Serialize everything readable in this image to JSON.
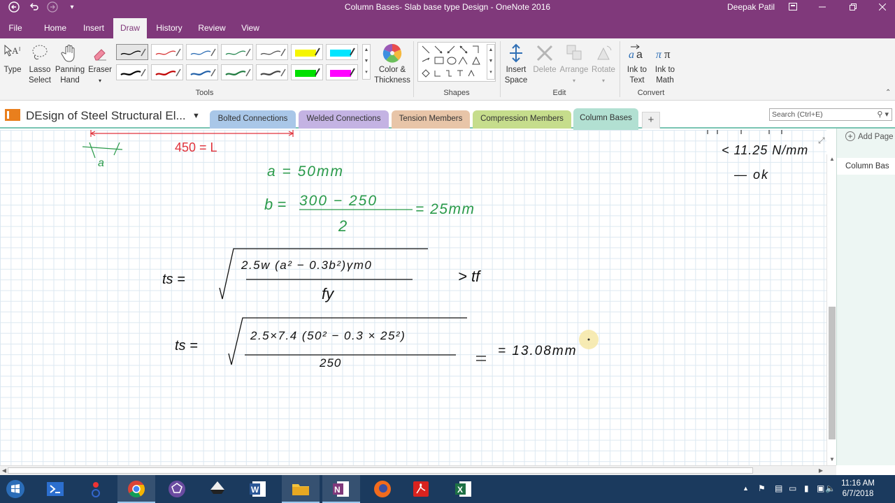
{
  "window": {
    "title": "Column Bases- Slab base type Design  -  OneNote 2016",
    "user": "Deepak Patil"
  },
  "menu": {
    "tabs": [
      "File",
      "Home",
      "Insert",
      "Draw",
      "History",
      "Review",
      "View"
    ],
    "active": "Draw"
  },
  "ribbon": {
    "type_label": "Type",
    "lasso_label": [
      "Lasso",
      "Select"
    ],
    "panning_label": [
      "Panning",
      "Hand"
    ],
    "eraser_label": "Eraser",
    "color_label": [
      "Color &",
      "Thickness"
    ],
    "insert_space_label": [
      "Insert",
      "Space"
    ],
    "delete_label": "Delete",
    "arrange_label": "Arrange",
    "rotate_label": "Rotate",
    "ink_text_label": [
      "Ink to",
      "Text"
    ],
    "ink_math_label": [
      "Ink to",
      "Math"
    ],
    "groups": {
      "tools": "Tools",
      "shapes": "Shapes",
      "edit": "Edit",
      "convert": "Convert"
    },
    "pen_colors": [
      "#000000",
      "#d83b3b",
      "#2f6fb5",
      "#2e8b57",
      "#555555",
      "#f5f500",
      "#00e5ff",
      "#000000",
      "#c00000",
      "#1f5fa8",
      "#1f7a3f",
      "#444444",
      "#00e000",
      "#ff00ff"
    ]
  },
  "notebook": {
    "name": "DEsign of Steel Structural El...",
    "sections": [
      {
        "label": "Bolted Connections",
        "color": "#a9c7e8"
      },
      {
        "label": "Welded Connections",
        "color": "#c4b3e3"
      },
      {
        "label": "Tension Members",
        "color": "#e8c5a8"
      },
      {
        "label": "Compression Members",
        "color": "#c6dd8c"
      },
      {
        "label": "Column Bases",
        "color": "#b2e0d2"
      }
    ],
    "active_section": "Column Bases",
    "search_placeholder": "Search (Ctrl+E)"
  },
  "pages": {
    "add_label": "Add Page",
    "items": [
      "Column Bas"
    ]
  },
  "ink": {
    "dim_label": "450 = L",
    "a_label": "a",
    "line_a": "a = 50mm",
    "b_lhs": "b =",
    "b_num": "300 − 250",
    "b_den": "2",
    "b_result": "= 25mm",
    "ts_lhs": "ts =",
    "ts_num": "2.5w (a² − 0.3b²)γm0",
    "ts_den": "fy",
    "ts_cmp": "> tf",
    "ts2_lhs": "ts =",
    "ts2_num": "2.5×7.4 (50² − 0.3 × 25²)",
    "ts2_den": "250",
    "ts2_result": "= 13.08mm",
    "side_line1": "< 11.25 N/mm",
    "side_line2": "— ok"
  },
  "taskbar": {
    "time": "11:16 AM",
    "date": "6/7/2018"
  }
}
